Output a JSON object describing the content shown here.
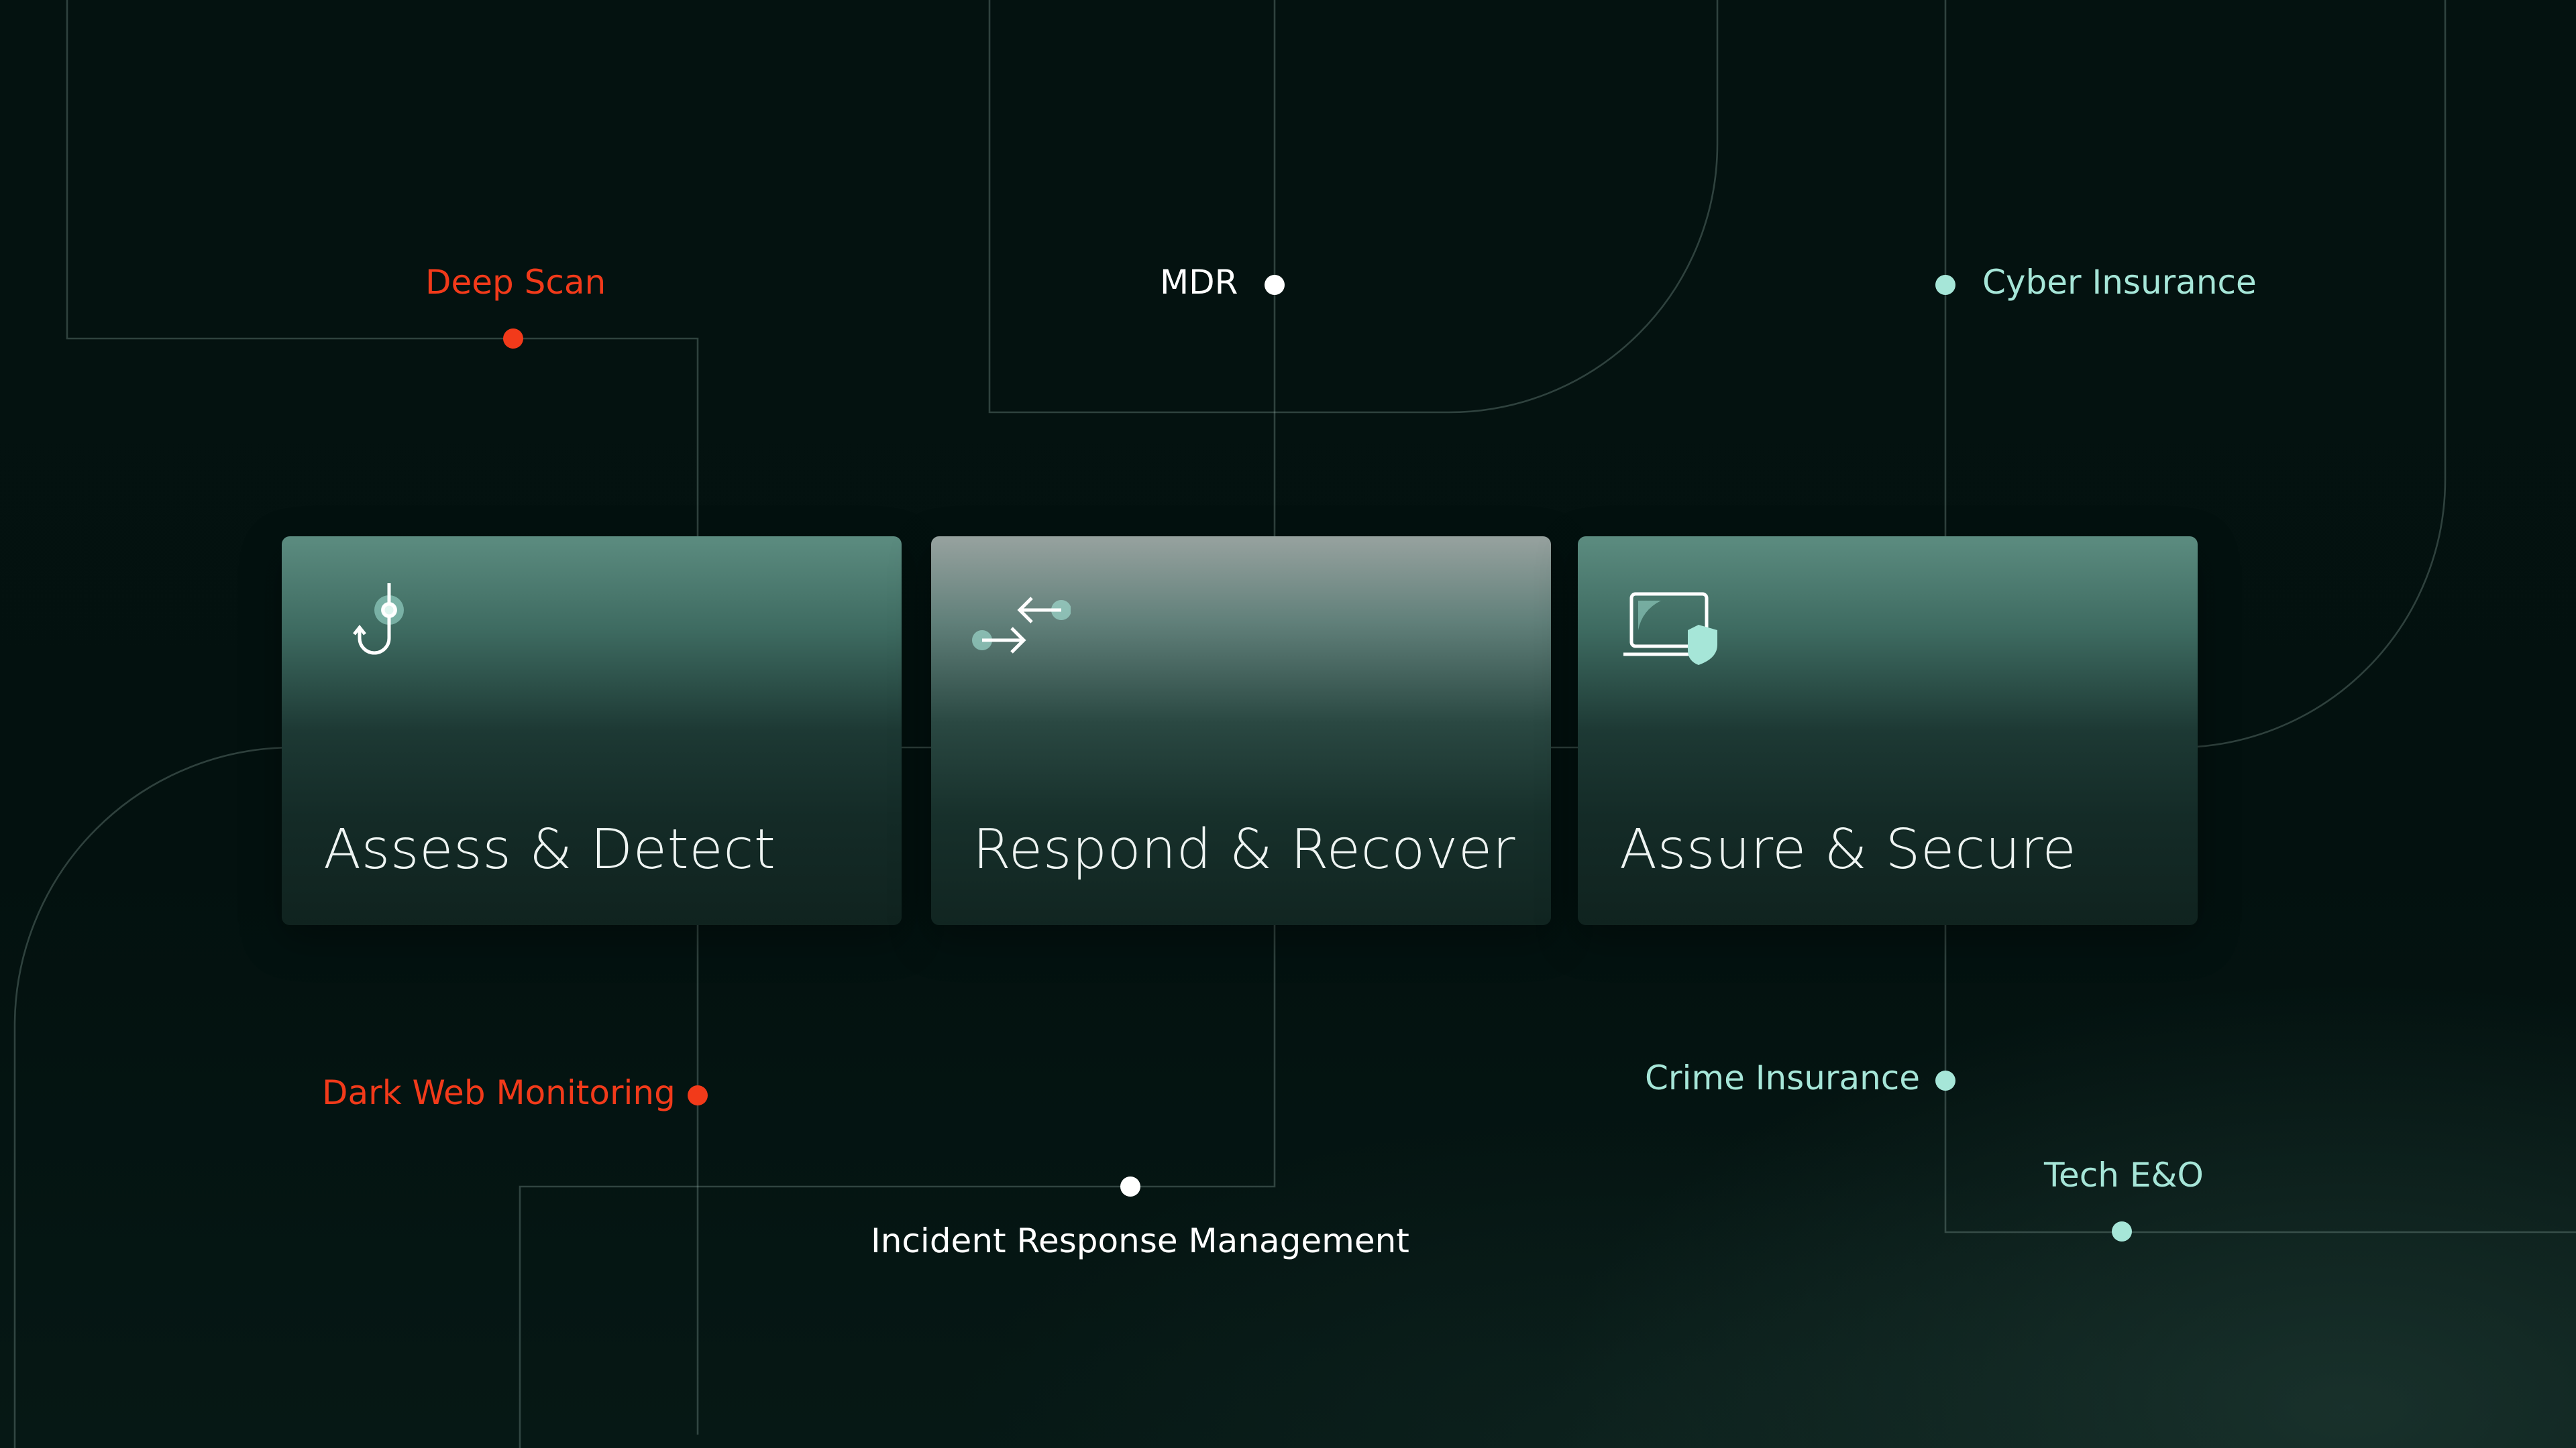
{
  "colors": {
    "accent_red": "#f23a1a",
    "accent_mint": "#a6e6d8",
    "white": "#ffffff"
  },
  "cards": [
    {
      "title": "Assess & Detect",
      "icon": "fishing-hook-icon"
    },
    {
      "title": "Respond & Recover",
      "icon": "arrows-exchange-icon"
    },
    {
      "title": "Assure & Secure",
      "icon": "laptop-shield-icon"
    }
  ],
  "services": {
    "deep_scan": "Deep Scan",
    "mdr": "MDR",
    "cyber_insurance": "Cyber Insurance",
    "dark_web_monitoring": "Dark Web Monitoring",
    "incident_response_management": "Incident Response Management",
    "crime_insurance": "Crime Insurance",
    "tech_eo": "Tech E&O"
  }
}
